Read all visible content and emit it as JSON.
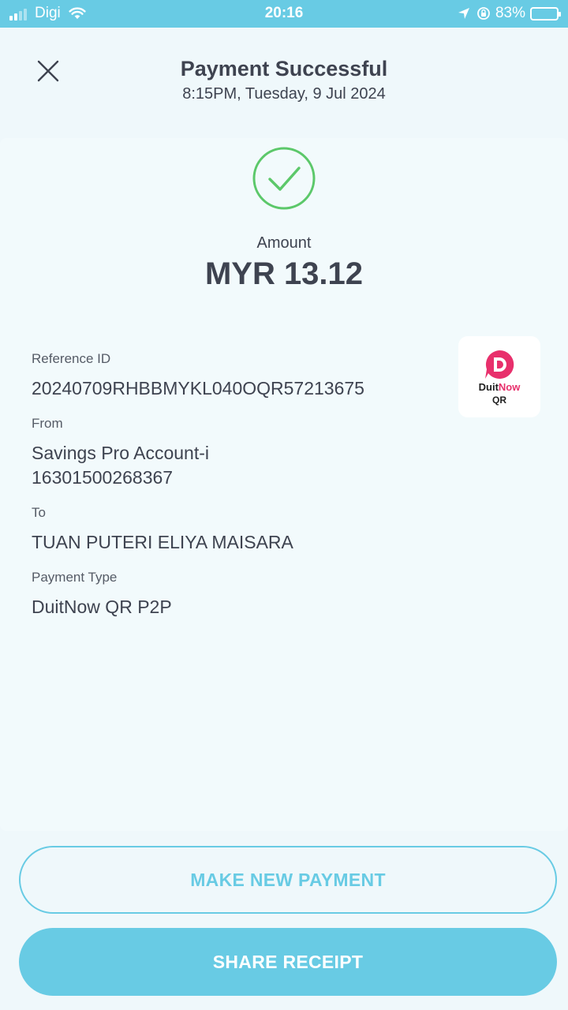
{
  "status_bar": {
    "carrier": "Digi",
    "time": "20:16",
    "battery": "83%",
    "battery_level": 0.83,
    "icons": [
      "signal-icon",
      "wifi-icon",
      "location-arrow-icon",
      "rotation-lock-icon",
      "battery-icon"
    ]
  },
  "header": {
    "title": "Payment Successful",
    "datetime": "8:15PM, Tuesday, 9 Jul 2024",
    "close_icon": "close-icon"
  },
  "summary": {
    "status_icon": "check-circle-icon",
    "amount_label": "Amount",
    "amount": "MYR 13.12"
  },
  "details": {
    "reference_label": "Reference ID",
    "reference_value": "20240709RHBBMYKL040OQR57213675",
    "from_label": "From",
    "from_account": "Savings Pro Account-i",
    "from_number": "16301500268367",
    "to_label": "To",
    "to_value": "TUAN PUTERI ELIYA MAISARA",
    "type_label": "Payment Type",
    "type_value": "DuitNow QR P2P"
  },
  "logo": {
    "name_part1": "Duit",
    "name_part2": "Now",
    "sub": "QR"
  },
  "actions": {
    "new_payment": "MAKE NEW PAYMENT",
    "share_receipt": "SHARE RECEIPT"
  },
  "colors": {
    "accent": "#68cbe4",
    "success": "#5cc86a",
    "brand_pink": "#e8306c",
    "text": "#3e4350",
    "background": "#eff8fb"
  }
}
